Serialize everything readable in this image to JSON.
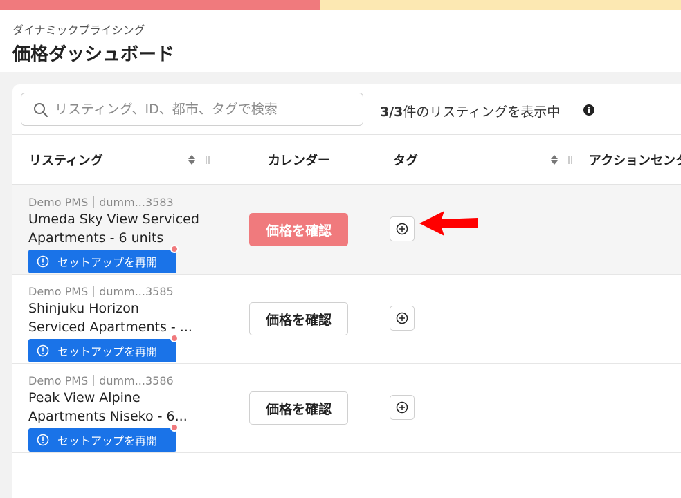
{
  "progress": {
    "value": 0.47,
    "fill_color": "#f07a7d",
    "track_color": "#fce8b2"
  },
  "header": {
    "subtitle": "ダイナミックプライシング",
    "title": "価格ダッシュボード"
  },
  "toolbar": {
    "search_placeholder": "リスティング、ID、都市、タグで検索",
    "search_value": "",
    "count_bold": "3/3",
    "count_text": "件のリスティングを表示中"
  },
  "columns": {
    "listing": "リスティング",
    "calendar": "カレンダー",
    "tags": "タグ",
    "action_center": "アクションセンター"
  },
  "rows": [
    {
      "meta": "Demo PMS｜dumm...3583",
      "name_line1": "Umeda Sky View Serviced",
      "name_line2": "Apartments - 6 units",
      "setup_label": "セットアップを再開",
      "price_label": "価格を確認"
    },
    {
      "meta": "Demo PMS｜dumm...3585",
      "name_line1": "Shinjuku Horizon",
      "name_line2": "Serviced Apartments - ...",
      "setup_label": "セットアップを再開",
      "price_label": "価格を確認"
    },
    {
      "meta": "Demo PMS｜dumm...3586",
      "name_line1": "Peak View Alpine",
      "name_line2": "Apartments Niseko - 6...",
      "setup_label": "セットアップを再開",
      "price_label": "価格を確認"
    }
  ],
  "colors": {
    "accent": "#f07a7d",
    "setup_blue": "#1a73e8",
    "arrow_red": "#ff0000"
  }
}
